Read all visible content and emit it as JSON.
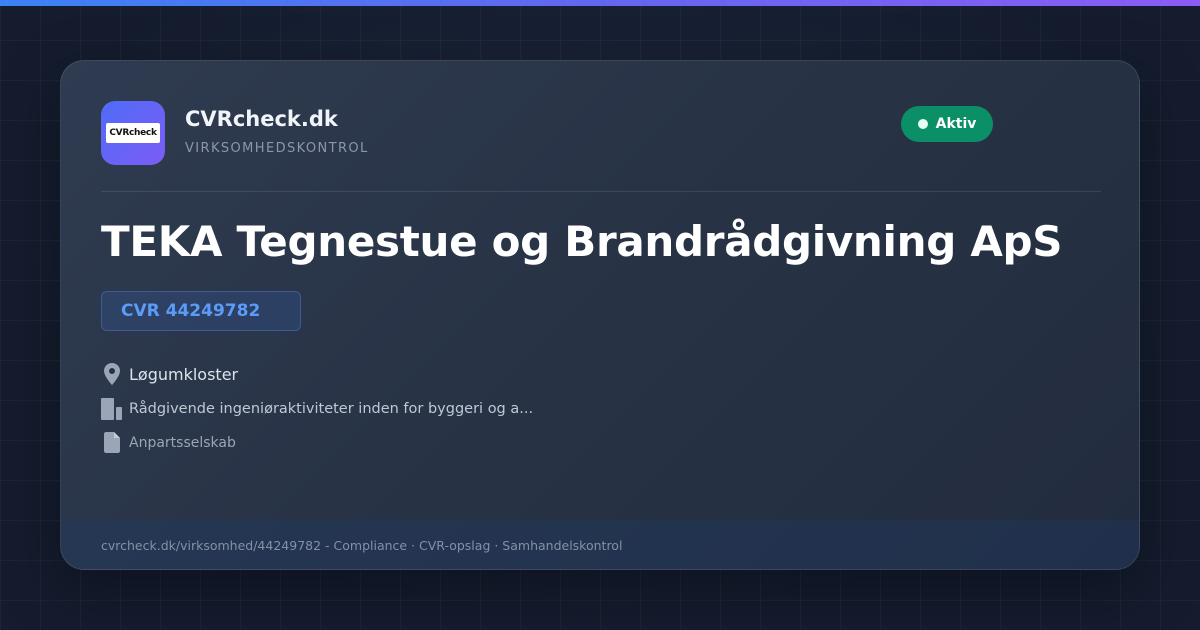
{
  "brand": {
    "logo_text": "CVRcheck",
    "name": "CVRcheck.dk",
    "tagline": "VIRKSOMHEDSKONTROL"
  },
  "status": {
    "label": "Aktiv",
    "color": "#0a8f66"
  },
  "company": {
    "name": "TEKA Tegnestue og Brandrådgivning ApS",
    "cvr": "CVR 44249782",
    "location": "Løgumkloster",
    "industry": "Rådgivende ingeniøraktiviteter inden for byggeri og a...",
    "legal_form": "Anpartsselskab"
  },
  "icons": {
    "location": "map-pin-icon",
    "industry": "building-icon",
    "legal_form": "document-icon"
  },
  "footer": {
    "text": "cvrcheck.dk/virksomhed/44249782 - Compliance · CVR-opslag · Samhandelskontrol"
  },
  "colors": {
    "accent": "#3b82f6",
    "accent_purple": "#8b5cf6",
    "background": "#141c2e",
    "card": "#283346"
  }
}
